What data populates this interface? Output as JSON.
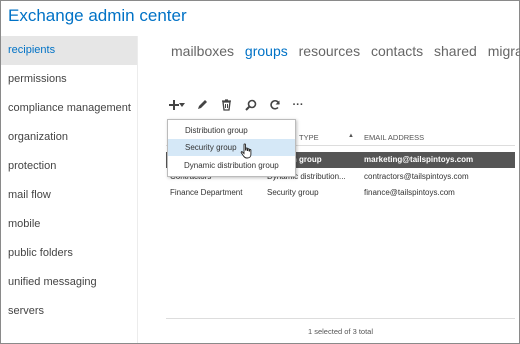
{
  "app": {
    "title": "Exchange admin center"
  },
  "sidebar": {
    "items": [
      {
        "label": "recipients",
        "active": true
      },
      {
        "label": "permissions"
      },
      {
        "label": "compliance management"
      },
      {
        "label": "organization"
      },
      {
        "label": "protection"
      },
      {
        "label": "mail flow"
      },
      {
        "label": "mobile"
      },
      {
        "label": "public folders"
      },
      {
        "label": "unified messaging"
      },
      {
        "label": "servers"
      }
    ]
  },
  "tabs": [
    {
      "label": "mailboxes"
    },
    {
      "label": "groups",
      "active": true
    },
    {
      "label": "resources"
    },
    {
      "label": "contacts"
    },
    {
      "label": "shared"
    },
    {
      "label": "migration"
    }
  ],
  "toolbar": {
    "icons": [
      "add-icon",
      "chevron-down-icon",
      "edit-icon",
      "delete-icon",
      "search-icon",
      "refresh-icon",
      "more-icon"
    ],
    "more_label": "···"
  },
  "dropdown": {
    "items": [
      {
        "label": "Distribution group"
      },
      {
        "label": "Security group",
        "hover": true
      },
      {
        "label": "Dynamic distribution group"
      }
    ]
  },
  "grid": {
    "columns": {
      "type": "TYPE",
      "email": "EMAIL ADDRESS"
    },
    "sort_indicator": "▲",
    "rows": [
      {
        "name": "",
        "type": "ribution group",
        "email": "marketing@tailspintoys.com",
        "selected": true
      },
      {
        "name": "Contractors",
        "type": "Dynamic distribution...",
        "email": "contractors@tailspintoys.com"
      },
      {
        "name": "Finance Department",
        "type": "Security group",
        "email": "finance@tailspintoys.com"
      }
    ]
  },
  "footer": {
    "status": "1 selected of 3 total"
  },
  "colors": {
    "accent": "#0072c6",
    "selected_row": "#555555",
    "sidebar_active": "#e6e6e6"
  }
}
